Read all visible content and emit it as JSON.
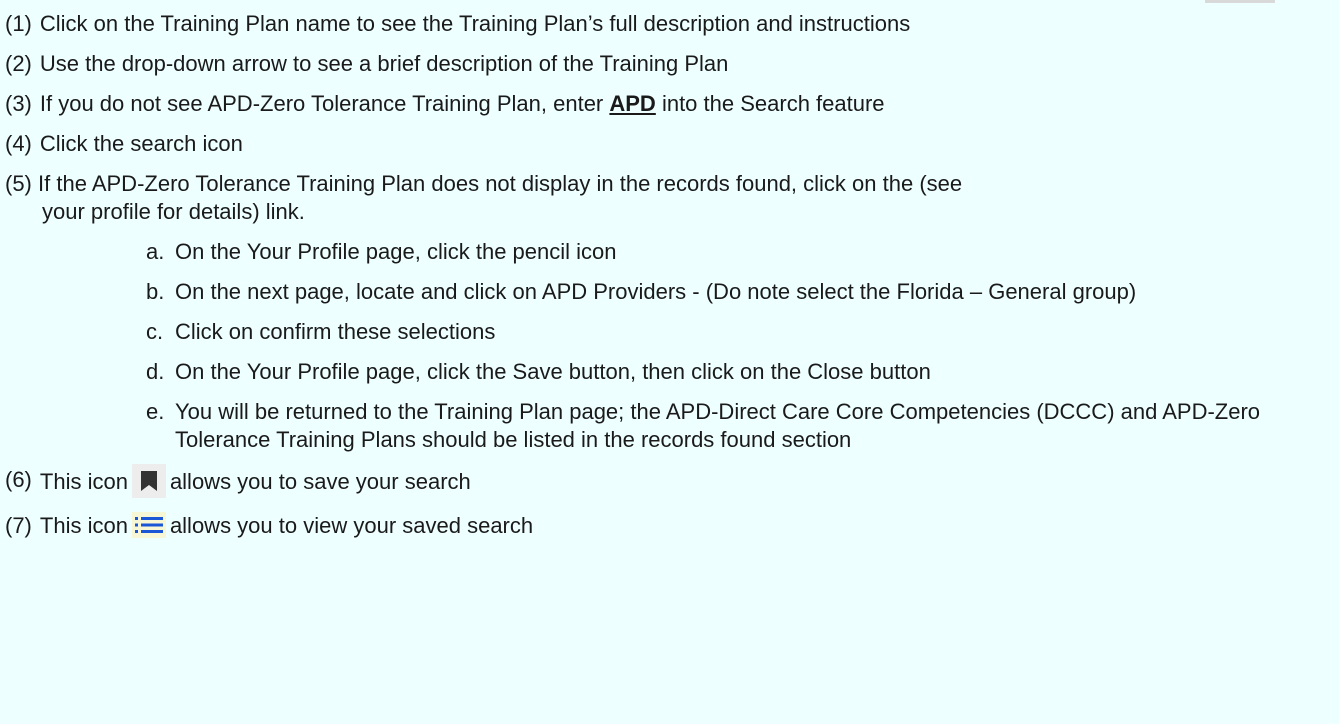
{
  "steps": [
    {
      "num": "(1)",
      "text": "Click on the Training Plan name to see the Training Plan’s full description and instructions"
    },
    {
      "num": "(2)",
      "text": "Use the drop-down arrow to see a brief description of the Training Plan"
    },
    {
      "num": "(3)",
      "pre": "If you do not see APD-Zero Tolerance Training Plan, enter ",
      "keyword": "APD",
      "post": " into the Search feature"
    },
    {
      "num": "(4)",
      "text": " Click the search icon"
    },
    {
      "num": "(5)",
      "line1": "If the APD-Zero Tolerance Training Plan does not display in the records found, click on the (see",
      "line2": "your profile for details) link.",
      "sub_items": [
        {
          "letter": "a.",
          "text": "On the Your Profile page, click the pencil icon"
        },
        {
          "letter": "b.",
          "text": "On the next page, locate and click on APD Providers - (Do note select the Florida – General group)"
        },
        {
          "letter": "c.",
          "text": "Click on confirm these selections"
        },
        {
          "letter": "d.",
          "text": "On the Your Profile page, click the Save button, then click on the Close button"
        },
        {
          "letter": "e.",
          "text": "You will be returned to the Training Plan page; the APD-Direct Care Core Competencies (DCCC) and APD-Zero Tolerance Training Plans should be listed in the records found section"
        }
      ]
    },
    {
      "num": "(6)",
      "pre": "This icon",
      "icon": "bookmark-icon",
      "post": "allows you to save your search"
    },
    {
      "num": "(7)",
      "pre": "This icon",
      "icon": "list-icon",
      "post": "allows you to view your saved search"
    }
  ],
  "colors": {
    "background": "#eeffff",
    "text": "#1a1a1a",
    "bookmark_icon": "#333333",
    "list_icon": "#1a56d6"
  }
}
